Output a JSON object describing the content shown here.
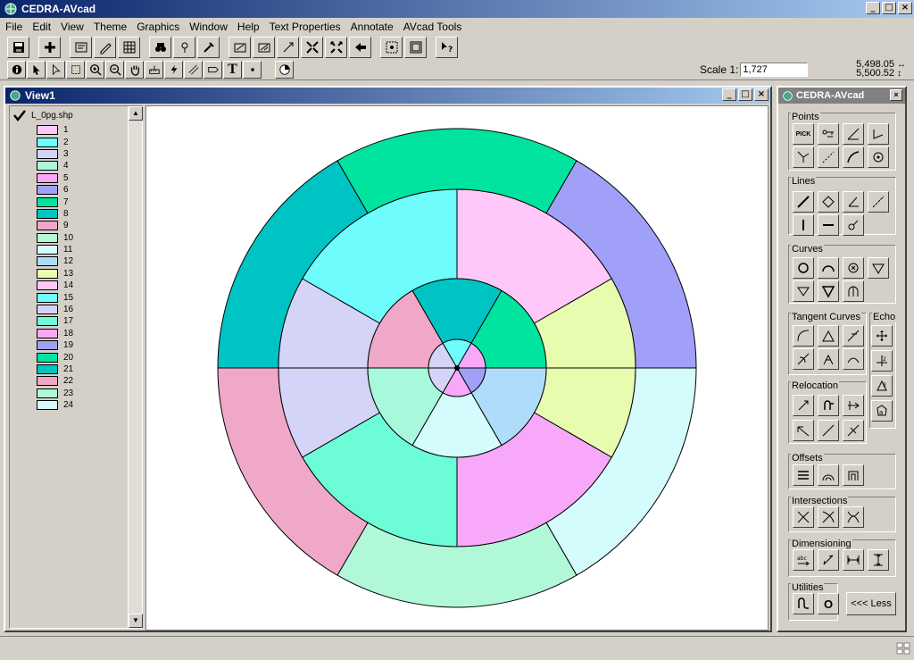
{
  "app": {
    "title": "CEDRA-AVcad",
    "min_label": "_",
    "max_label": "□",
    "close_label": "×"
  },
  "menu": [
    "File",
    "Edit",
    "View",
    "Theme",
    "Graphics",
    "Window",
    "Help",
    "Text Properties",
    "Annotate",
    "AVcad Tools"
  ],
  "toolbar": {
    "scale_label": "Scale 1:",
    "scale_value": "1,727",
    "x_coord": "5,498.05",
    "y_coord": "5,500.52",
    "text_tool_label": "T"
  },
  "view": {
    "title": "View1",
    "layer_name": "L_0pg.shp",
    "legend": [
      {
        "label": "1",
        "color": "#ffc8f8"
      },
      {
        "label": "2",
        "color": "#6efcfc"
      },
      {
        "label": "3",
        "color": "#d4d4f8"
      },
      {
        "label": "4",
        "color": "#a8f8dc"
      },
      {
        "label": "5",
        "color": "#f8a8f8"
      },
      {
        "label": "6",
        "color": "#a0a0f8"
      },
      {
        "label": "7",
        "color": "#00e4a0"
      },
      {
        "label": "8",
        "color": "#00c4c4"
      },
      {
        "label": "9",
        "color": "#f0a8c8"
      },
      {
        "label": "10",
        "color": "#b0f8d8"
      },
      {
        "label": "11",
        "color": "#d4fcfc"
      },
      {
        "label": "12",
        "color": "#b0dcfc"
      },
      {
        "label": "13",
        "color": "#e8fcb0"
      },
      {
        "label": "14",
        "color": "#ffc8f8"
      },
      {
        "label": "15",
        "color": "#6efcfc"
      },
      {
        "label": "16",
        "color": "#d4d4f8"
      },
      {
        "label": "17",
        "color": "#6cfcd8"
      },
      {
        "label": "18",
        "color": "#f8a8f8"
      },
      {
        "label": "19",
        "color": "#a0a0f8"
      },
      {
        "label": "20",
        "color": "#00e4a0"
      },
      {
        "label": "21",
        "color": "#00c4c4"
      },
      {
        "label": "22",
        "color": "#f0a8c8"
      },
      {
        "label": "23",
        "color": "#b0f8d8"
      },
      {
        "label": "24",
        "color": "#d4fcfc"
      }
    ]
  },
  "panel": {
    "title": "CEDRA-AVcad",
    "groups": {
      "points": "Points",
      "lines": "Lines",
      "curves": "Curves",
      "tangent": "Tangent Curves",
      "echo": "Echo",
      "relocation": "Relocation",
      "offsets": "Offsets",
      "intersections": "Intersections",
      "dimensioning": "Dimensioning",
      "utilities": "Utilities"
    },
    "pick_label": "PICK",
    "less_label": "<<< Less",
    "utility_o_label": "O"
  },
  "figure": {
    "rings": [
      {
        "name": "outer",
        "colors": [
          "#00e4a0",
          "#a0a0f8",
          "#d4fcfc",
          "#b0f8d8",
          "#f0a8c8",
          "#00c4c4"
        ]
      },
      {
        "name": "middle",
        "colors": [
          "#ffc8f8",
          "#e8fcb0",
          "#f8a8f8",
          "#6cfcd8",
          "#d4d4f8",
          "#6efcfc"
        ]
      },
      {
        "name": "inner",
        "colors": [
          "#00c4c4",
          "#00e4a0",
          "#b0dcfc",
          "#d4fcfc",
          "#a8f8dc",
          "#f0a8c8"
        ]
      },
      {
        "name": "center",
        "colors": [
          "#6efcfc",
          "#f8a8f8",
          "#a0a0f8",
          "#f8a8f8",
          "#d4d4f8",
          "#d4d4f8"
        ]
      }
    ]
  }
}
